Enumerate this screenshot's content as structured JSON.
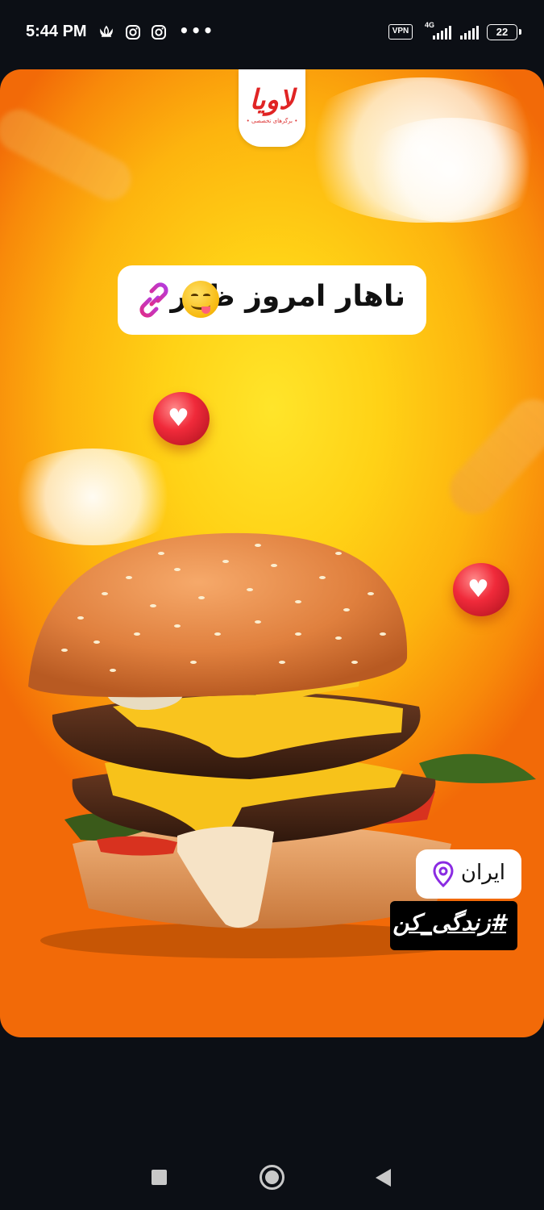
{
  "status_bar": {
    "time": "5:44 PM",
    "icons": [
      "lotus-icon",
      "instagram-icon",
      "instagram-icon",
      "more-dots-icon",
      "vpn-icon",
      "signal-icon",
      "signal-icon",
      "battery-icon"
    ],
    "more_dots": "•••",
    "vpn_label": "VPN",
    "network_type": "4G",
    "battery_level": "22"
  },
  "story": {
    "brand": {
      "logo_text": "لاویا",
      "logo_subtext": "• برگرهای تخصصی •",
      "color": "#e02424"
    },
    "lunch_sticker": {
      "text": "ناهار امروز ظهر",
      "emoji": "yum-face-emoji",
      "link_icon": "link-icon"
    },
    "location_sticker": {
      "text": "ایران",
      "icon": "location-pin-icon",
      "icon_color": "#8a2be2"
    },
    "hashtag_sticker": {
      "text": "#زندگی_کن"
    },
    "heart_symbol": "♥",
    "background_colors": [
      "#ffe52a",
      "#fdb40e",
      "#f26a08"
    ]
  },
  "nav_bar": {
    "buttons": [
      "recents-button",
      "home-button",
      "back-button"
    ]
  }
}
